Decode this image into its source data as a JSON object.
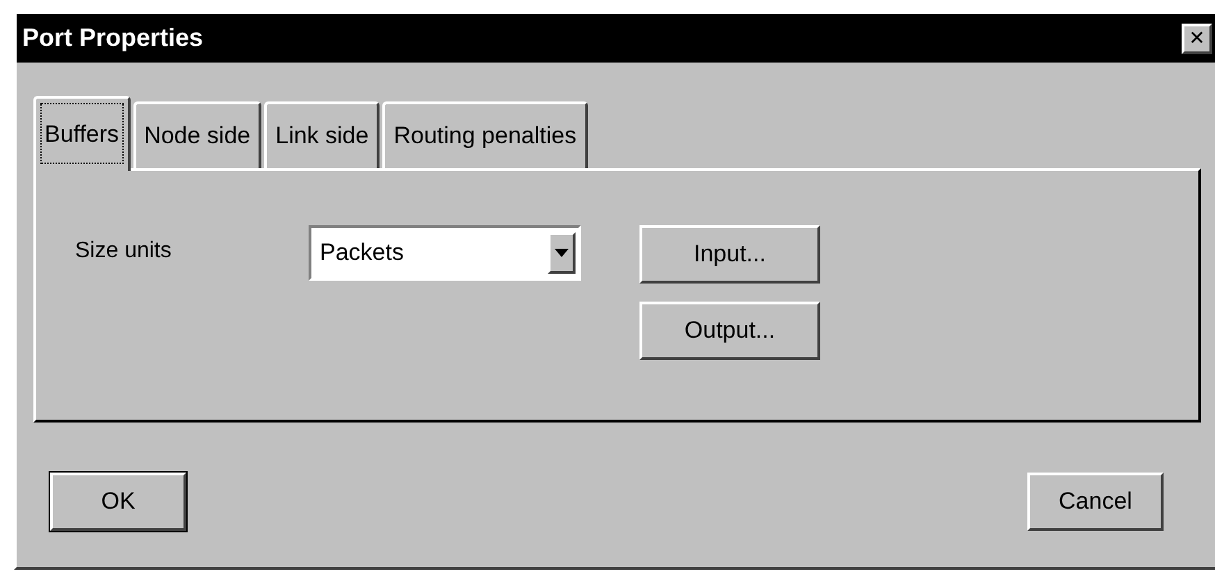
{
  "window": {
    "title": "Port Properties",
    "close": "✕"
  },
  "tabs": [
    {
      "label": "Buffers",
      "selected": true
    },
    {
      "label": "Node side",
      "selected": false
    },
    {
      "label": "Link side",
      "selected": false
    },
    {
      "label": "Routing penalties",
      "selected": false
    }
  ],
  "size_units": {
    "label": "Size units",
    "value": "Packets"
  },
  "panel_buttons": [
    "Input...",
    "Output..."
  ],
  "buttons": [
    {
      "label": "OK",
      "default": true
    },
    {
      "label": "Cancel",
      "default": false
    }
  ]
}
